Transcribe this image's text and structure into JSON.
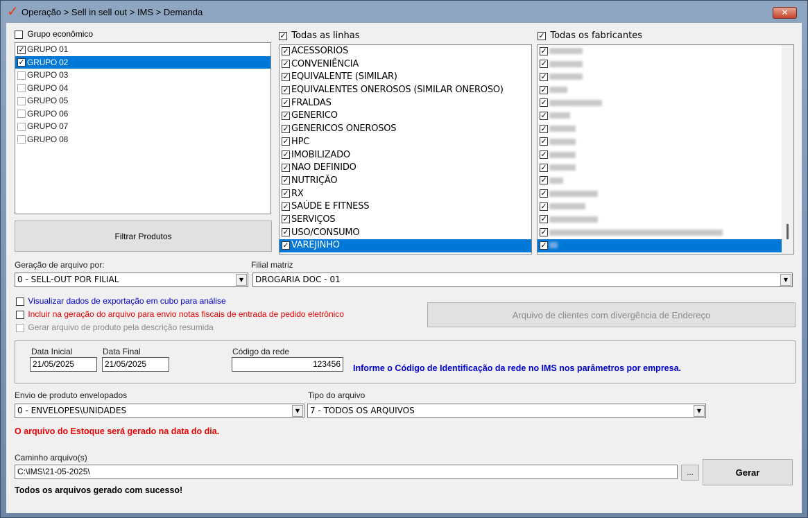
{
  "window": {
    "title": "Operação > Sell in sell out > IMS > Demanda",
    "close_glyph": "✕"
  },
  "grupo": {
    "header": "Grupo econômico",
    "header_checked": false,
    "items": [
      {
        "label": "GRUPO 01",
        "checked": true,
        "selected": false
      },
      {
        "label": "GRUPO 02",
        "checked": true,
        "selected": true
      },
      {
        "label": "GRUPO 03",
        "checked": false,
        "selected": false
      },
      {
        "label": "GRUPO 04",
        "checked": false,
        "selected": false
      },
      {
        "label": "GRUPO 05",
        "checked": false,
        "selected": false
      },
      {
        "label": "GRUPO 06",
        "checked": false,
        "selected": false
      },
      {
        "label": "GRUPO 07",
        "checked": false,
        "selected": false
      },
      {
        "label": "GRUPO 08",
        "checked": false,
        "selected": false
      }
    ]
  },
  "linhas": {
    "header": "Todas as linhas",
    "header_checked": true,
    "items": [
      {
        "label": "ACESSORIOS",
        "checked": true,
        "selected": false
      },
      {
        "label": "CONVENIÊNCIA",
        "checked": true,
        "selected": false
      },
      {
        "label": "EQUIVALENTE (SIMILAR)",
        "checked": true,
        "selected": false
      },
      {
        "label": "EQUIVALENTES ONEROSOS (SIMILAR ONEROSO)",
        "checked": true,
        "selected": false
      },
      {
        "label": "FRALDAS",
        "checked": true,
        "selected": false
      },
      {
        "label": "GENERICO",
        "checked": true,
        "selected": false
      },
      {
        "label": "GENERICOS ONEROSOS",
        "checked": true,
        "selected": false
      },
      {
        "label": "HPC",
        "checked": true,
        "selected": false
      },
      {
        "label": "IMOBILIZADO",
        "checked": true,
        "selected": false
      },
      {
        "label": "NAO DEFINIDO",
        "checked": true,
        "selected": false
      },
      {
        "label": "NUTRIÇÃO",
        "checked": true,
        "selected": false
      },
      {
        "label": "RX",
        "checked": true,
        "selected": false
      },
      {
        "label": "SAÚDE E FITNESS",
        "checked": true,
        "selected": false
      },
      {
        "label": "SERVIÇOS",
        "checked": true,
        "selected": false
      },
      {
        "label": "USO/CONSUMO",
        "checked": true,
        "selected": false
      },
      {
        "label": "VAREJINHO",
        "checked": true,
        "selected": true
      }
    ]
  },
  "fabricantes": {
    "header": "Todas os fabricantes",
    "header_checked": true,
    "items": [
      {
        "blur_width": 48,
        "checked": true,
        "selected": false
      },
      {
        "blur_width": 48,
        "checked": true,
        "selected": false
      },
      {
        "blur_width": 48,
        "checked": true,
        "selected": false
      },
      {
        "blur_width": 26,
        "checked": true,
        "selected": false
      },
      {
        "blur_width": 76,
        "checked": true,
        "selected": false
      },
      {
        "blur_width": 30,
        "checked": true,
        "selected": false
      },
      {
        "blur_width": 38,
        "checked": true,
        "selected": false
      },
      {
        "blur_width": 38,
        "checked": true,
        "selected": false
      },
      {
        "blur_width": 38,
        "checked": true,
        "selected": false
      },
      {
        "blur_width": 38,
        "checked": true,
        "selected": false
      },
      {
        "blur_width": 20,
        "checked": true,
        "selected": false
      },
      {
        "blur_width": 70,
        "checked": true,
        "selected": false
      },
      {
        "blur_width": 52,
        "checked": true,
        "selected": false
      },
      {
        "blur_width": 70,
        "checked": true,
        "selected": false
      },
      {
        "blur_width": 250,
        "checked": true,
        "selected": false
      },
      {
        "blur_width": 12,
        "checked": true,
        "selected": true
      }
    ]
  },
  "filtrar_button": "Filtrar Produtos",
  "geracao": {
    "label": "Geração de arquivo por:",
    "value": "0 - SELL-OUT POR FILIAL"
  },
  "filial": {
    "label": "Filial matriz",
    "value": "DROGARIA DOC - 01"
  },
  "options": {
    "cubo": "Visualizar dados de exportação em cubo para análise",
    "notas": "Incluir na geração do arquivo para envio notas fiscais de entrada de pedido eletrônico",
    "descricao": "Gerar arquivo de produto pela descrição resumida"
  },
  "divergencia_button": "Arquivo de clientes com divergência de Endereço",
  "datas": {
    "inicial_label": "Data Inicial",
    "inicial_value": "21/05/2025",
    "final_label": "Data Final",
    "final_value": "21/05/2025",
    "rede_label": "Código da rede",
    "rede_value": "123456",
    "info": "Informe o Código de Identificação da rede no IMS nos parâmetros por empresa."
  },
  "envio": {
    "label": "Envio de produto envelopados",
    "value": "0 - ENVELOPES\\UNIDADES"
  },
  "tipo": {
    "label": "Tipo do arquivo",
    "value": "7 - TODOS OS ARQUIVOS"
  },
  "estoque_msg": "O arquivo do Estoque será gerado na data do dia.",
  "caminho": {
    "label": "Caminho arquivo(s)",
    "value": "C:\\IMS\\21-05-2025\\",
    "browse": "..."
  },
  "gerar_button": "Gerar",
  "status": "Todos os arquivos gerado com sucesso!",
  "colors": {
    "selection": "#0078d7",
    "info_blue": "#0000cc",
    "warning_red": "#e60000"
  }
}
